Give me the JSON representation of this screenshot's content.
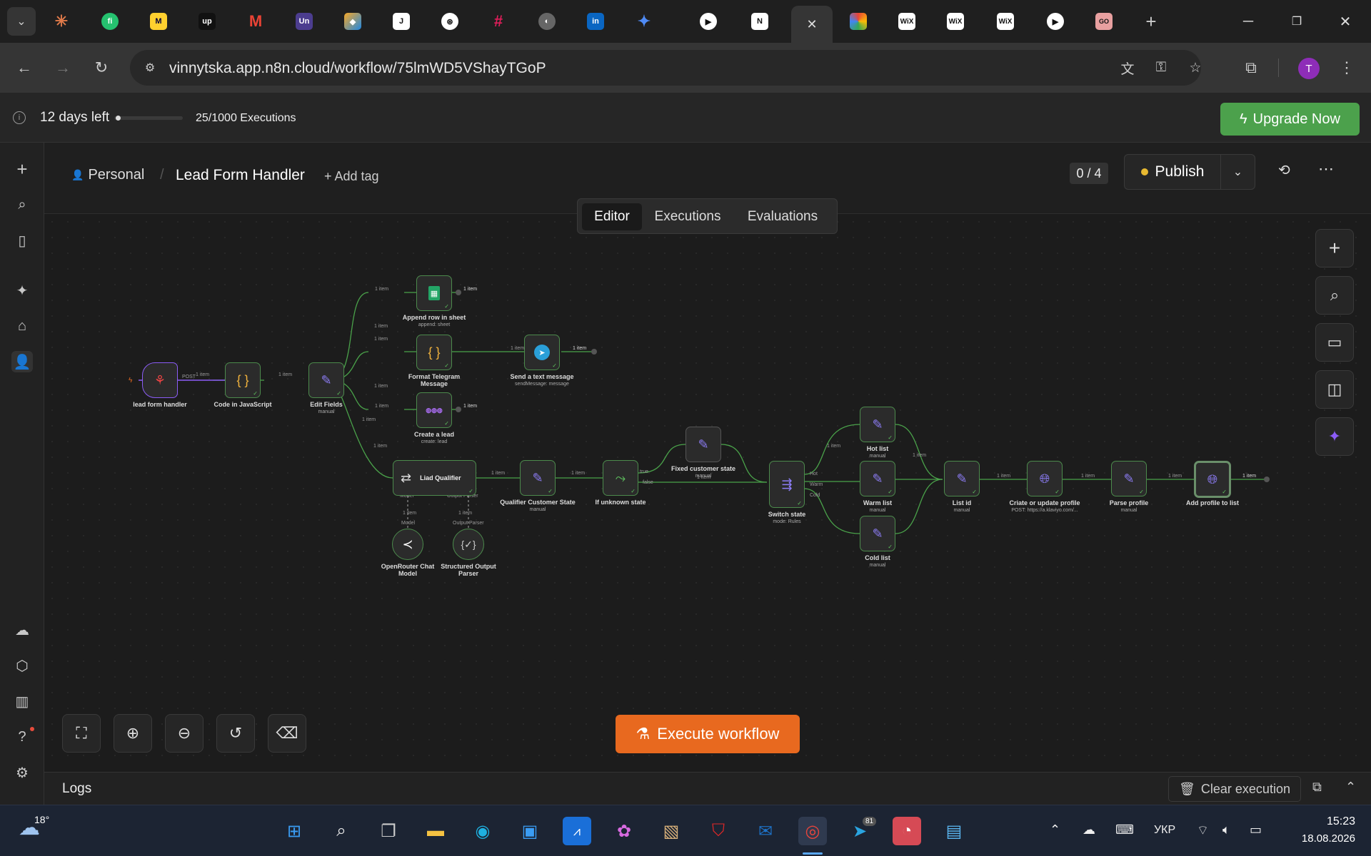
{
  "browser": {
    "tab_icons": [
      "claude-icon",
      "freshdesk-icon",
      "miro-icon",
      "upwork-icon",
      "gmail-icon",
      "unbounce-icon",
      "box-icon",
      "notion-like-icon",
      "chatgpt-icon",
      "slack-icon",
      "web-icon",
      "linkedin-icon",
      "gemini-icon",
      "zoom-icon",
      "notion-icon",
      "n8n-tab-icon",
      "color-icon",
      "wix-icon",
      "wix-icon",
      "wix-icon",
      "zoom-icon",
      "copilot-icon"
    ],
    "tab_close": "✕",
    "new_tab": "+",
    "url": "vinnytska.app.n8n.cloud/workflow/75lmWD5VShayTGoP",
    "avatar_letter": "T"
  },
  "trial": {
    "days_left": "12 days left",
    "executions": "25/1000 Executions",
    "progress": 0.025,
    "upgrade_label": "Upgrade Now"
  },
  "header": {
    "project": "Personal",
    "separator": "/",
    "workflow_name": "Lead Form Handler",
    "add_tag": "+ Add tag",
    "counter": "0 / 4",
    "publish": "Publish"
  },
  "tabs": [
    "Editor",
    "Executions",
    "Evaluations"
  ],
  "nodes": {
    "lead_form_handler": {
      "label": "lead form handler"
    },
    "code_js": {
      "label": "Code in JavaScript"
    },
    "edit_fields": {
      "label": "Edit Fields",
      "sub": "manual"
    },
    "append_row": {
      "label": "Append row in sheet",
      "sub": "append: sheet"
    },
    "format_telegram": {
      "label": "Format Telegram Message"
    },
    "send_text": {
      "label": "Send a text message",
      "sub": "sendMessage: message"
    },
    "create_lead": {
      "label": "Create a lead",
      "sub": "create: lead"
    },
    "liad_qualifier": {
      "label": "Liad Qualifier"
    },
    "qualifier_state": {
      "label": "Qualifier Customer State",
      "sub": "manual"
    },
    "if_unknown": {
      "label": "If unknown state"
    },
    "fixed_state": {
      "label": "Fixed customer state",
      "sub": "manual"
    },
    "switch_state": {
      "label": "Switch state",
      "sub": "mode: Rules"
    },
    "hot_list": {
      "label": "Hot list",
      "sub": "manual"
    },
    "warm_list": {
      "label": "Warm list",
      "sub": "manual"
    },
    "cold_list": {
      "label": "Cold list",
      "sub": "manual"
    },
    "list_id": {
      "label": "List id",
      "sub": "manual"
    },
    "create_profile": {
      "label": "Criate or update profile",
      "sub": "POST: https://a.klaviyo.com/..."
    },
    "parse_profile": {
      "label": "Parse profile",
      "sub": "manual"
    },
    "add_profile": {
      "label": "Add profile to list"
    },
    "openrouter": {
      "label": "OpenRouter Chat Model"
    },
    "output_parser": {
      "label": "Structured Output Parser"
    }
  },
  "edges": {
    "item": "1 item",
    "post": "POST",
    "true": "true",
    "false": "false",
    "hot": "Hot",
    "warm": "Warm",
    "cold": "Cold",
    "model": "Model*",
    "model_in": "Model",
    "output_parser": "Output Parser"
  },
  "execute_label": "Execute workflow",
  "logs": {
    "title": "Logs",
    "clear": "Clear execution"
  },
  "taskbar": {
    "weather": "18°",
    "telegram_badge": "81",
    "lang": "УКР",
    "time": "15:23",
    "date": "18.08.2026"
  }
}
